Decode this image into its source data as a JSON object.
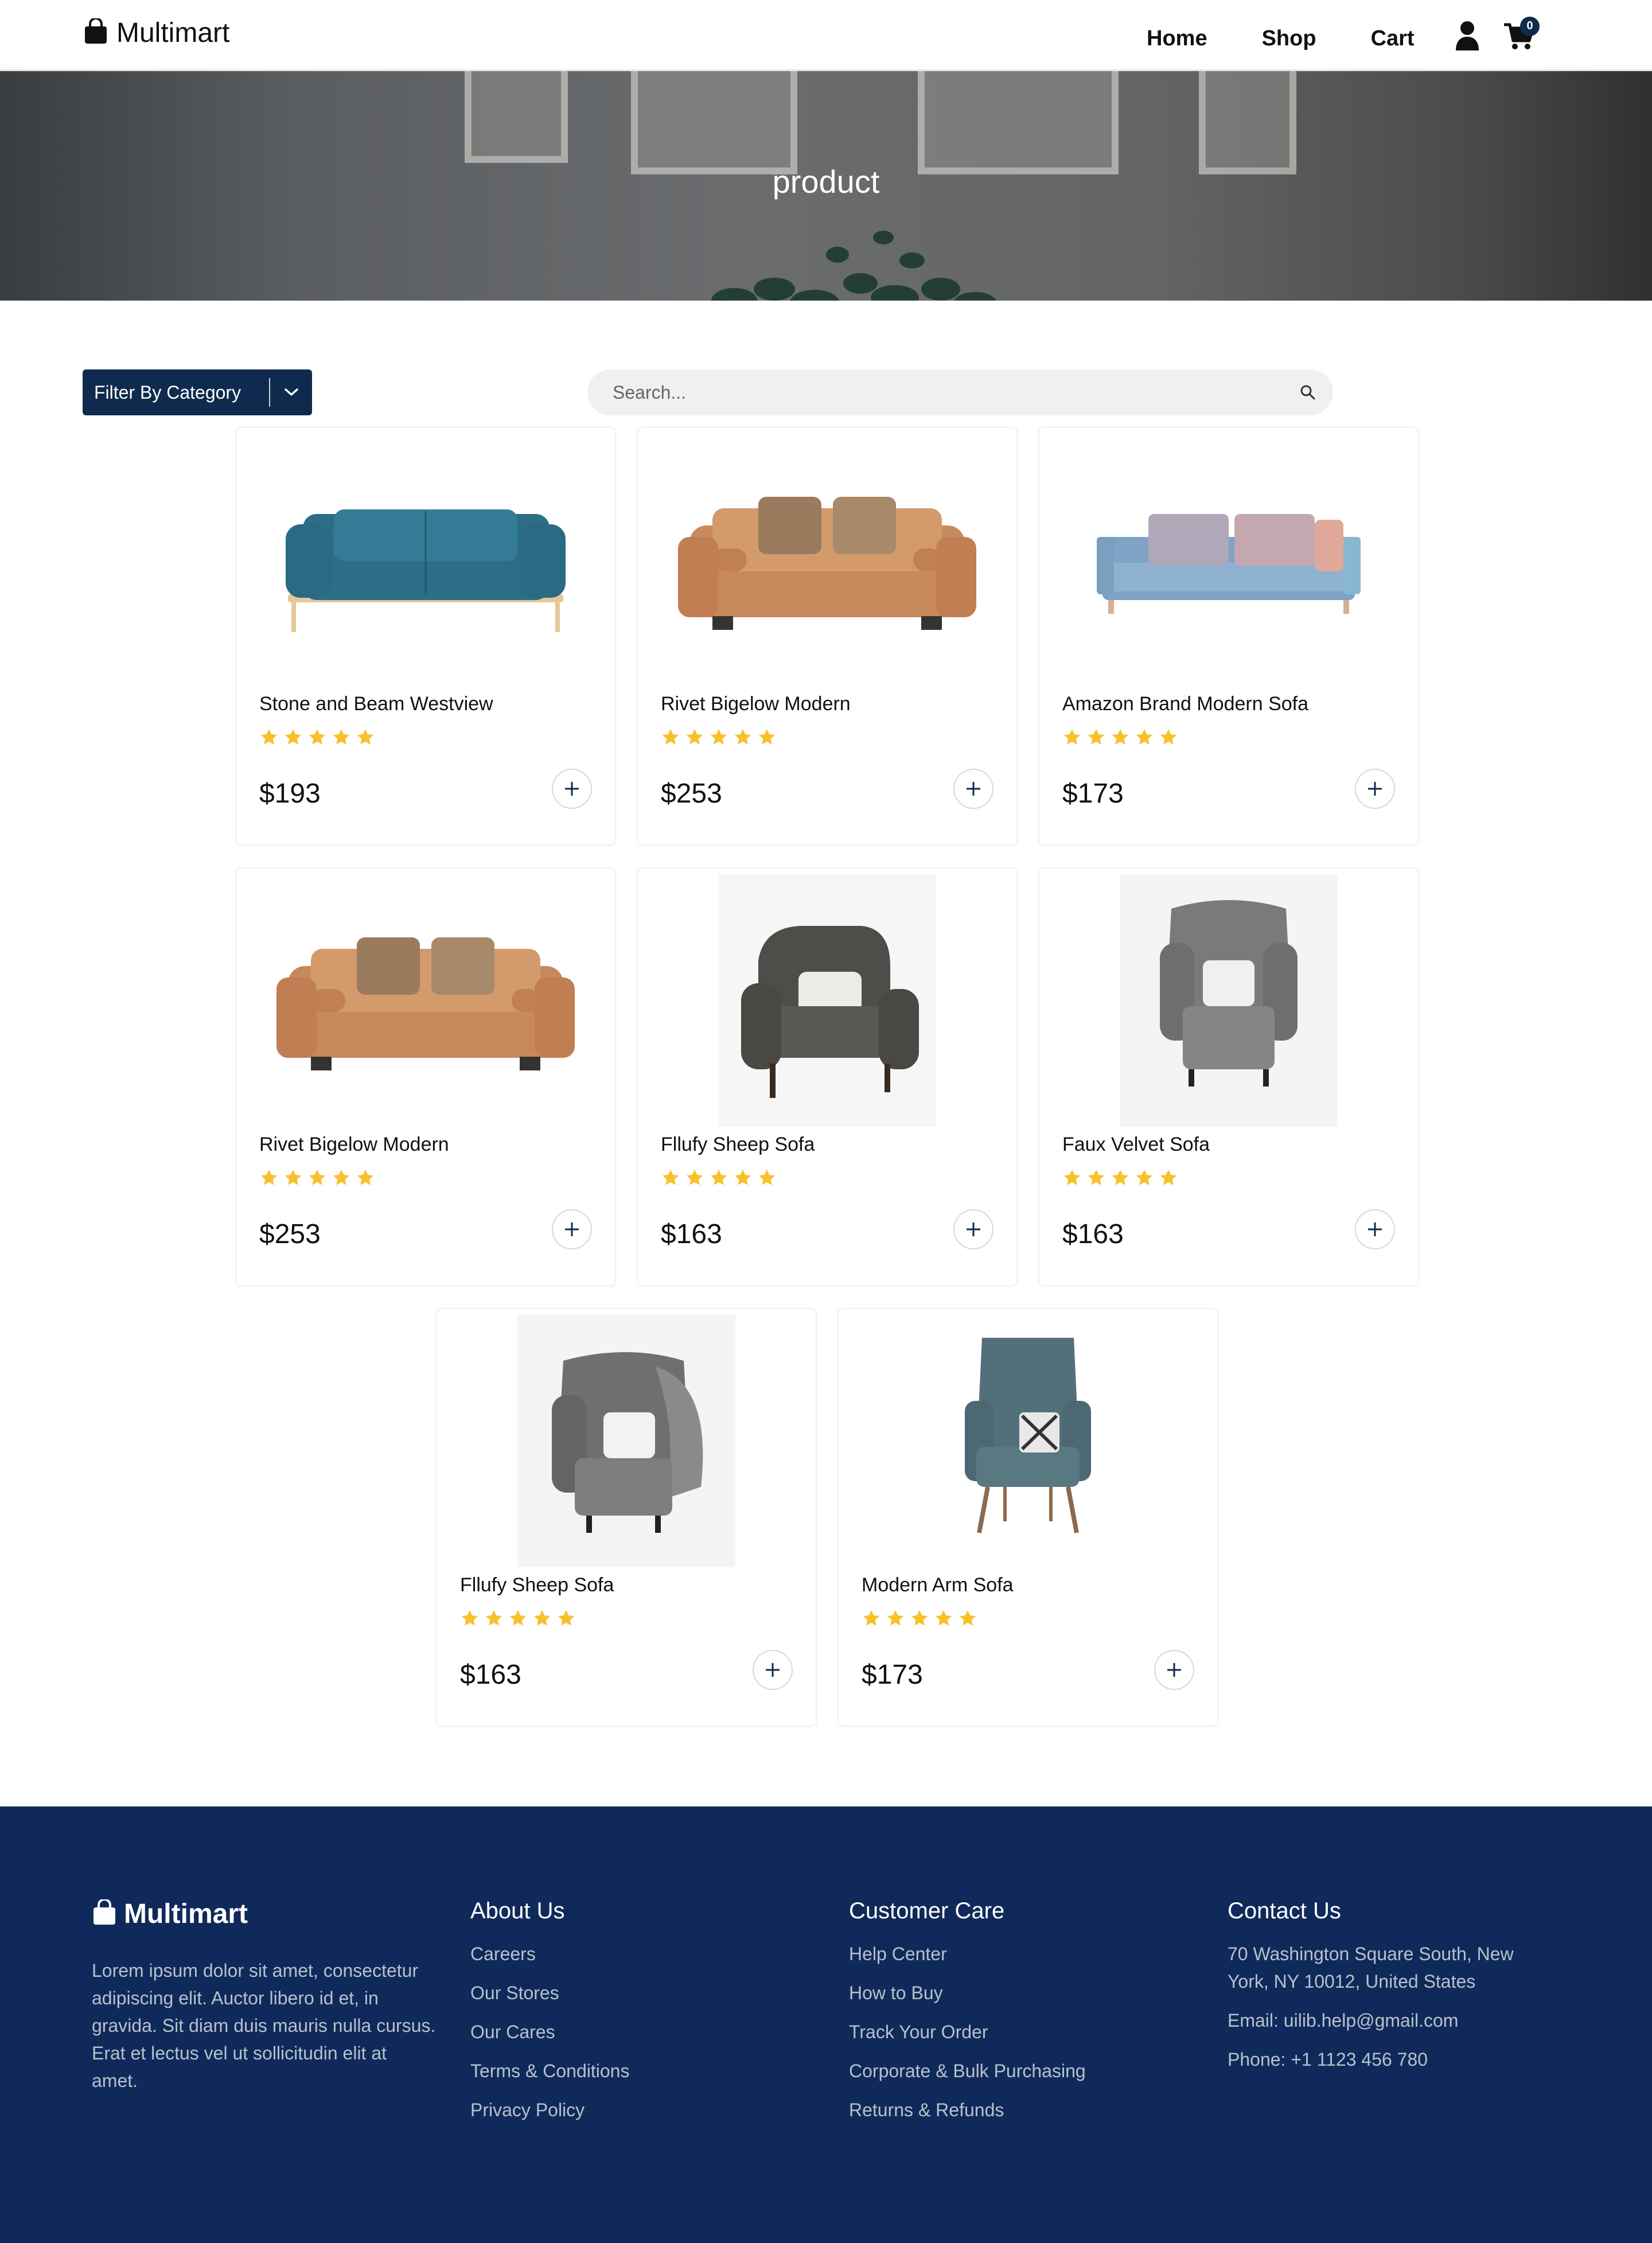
{
  "nav": {
    "brand": "Multimart",
    "links": [
      "Home",
      "Shop",
      "Cart"
    ],
    "cart_count": "0"
  },
  "hero": {
    "title": "product"
  },
  "toolbar": {
    "filter_label": "Filter By Category",
    "search_placeholder": "Search..."
  },
  "colors": {
    "primary": "#0f2a4e",
    "footer_bg": "#0f2a5a",
    "star": "#f8c12c",
    "footer_text": "#b8c0cc"
  },
  "products": [
    {
      "name": "Stone and Beam Westview",
      "price": "$193",
      "rating": 5,
      "image": "teal-sofa"
    },
    {
      "name": "Rivet Bigelow Modern",
      "price": "$253",
      "rating": 5,
      "image": "tan-sofa"
    },
    {
      "name": "Amazon Brand Modern Sofa",
      "price": "$173",
      "rating": 5,
      "image": "blue-sofa"
    },
    {
      "name": "Rivet Bigelow Modern",
      "price": "$253",
      "rating": 5,
      "image": "tan-sofa"
    },
    {
      "name": "Fllufy Sheep Sofa",
      "price": "$163",
      "rating": 5,
      "image": "gray-armchair"
    },
    {
      "name": "Faux Velvet Sofa",
      "price": "$163",
      "rating": 5,
      "image": "wingback-chair"
    },
    {
      "name": "Fllufy Sheep Sofa",
      "price": "$163",
      "rating": 5,
      "image": "wingback-fur-chair"
    },
    {
      "name": "Modern Arm Sofa",
      "price": "$173",
      "rating": 5,
      "image": "teal-arm-chair"
    }
  ],
  "footer": {
    "brand": "Multimart",
    "description": "Lorem ipsum dolor sit amet, consectetur adipiscing elit. Auctor libero id et, in gravida. Sit diam duis mauris nulla cursus. Erat et lectus vel ut sollicitudin elit at amet.",
    "about": {
      "title": "About Us",
      "links": [
        "Careers",
        "Our Stores",
        "Our Cares",
        "Terms & Conditions",
        "Privacy Policy"
      ]
    },
    "care": {
      "title": "Customer Care",
      "links": [
        "Help Center",
        "How to Buy",
        "Track Your Order",
        "Corporate & Bulk Purchasing",
        "Returns & Refunds"
      ]
    },
    "contact": {
      "title": "Contact Us",
      "address": "70 Washington Square South, New York, NY 10012, United States",
      "email": "Email: uilib.help@gmail.com",
      "phone": "Phone: +1 1123 456 780"
    }
  }
}
